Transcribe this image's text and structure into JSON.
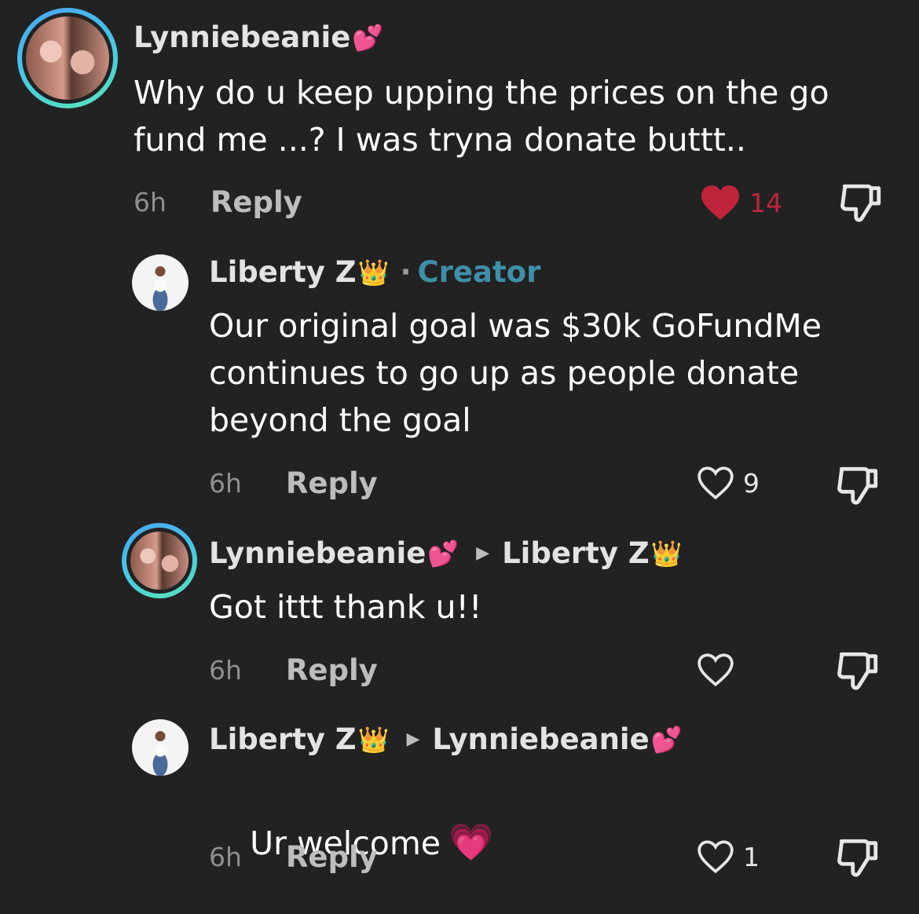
{
  "comments": [
    {
      "username": "Lynniebeanie",
      "username_emoji": "💕",
      "text": "Why do u keep upping the prices on the go\nfund me ...? I was tryna donate buttt..",
      "time": "6h",
      "reply_label": "Reply",
      "likes": "14",
      "liked": true
    },
    {
      "username": "Liberty Z",
      "username_emoji": "👑",
      "separator": "·",
      "badge": "Creator",
      "text": "Our original goal was $30k GoFundMe\ncontinues to go up as people donate\nbeyond the goal",
      "time": "6h",
      "reply_label": "Reply",
      "likes": "9",
      "liked": false
    },
    {
      "username": "Lynniebeanie",
      "username_emoji": "💕",
      "reply_to": "Liberty Z",
      "reply_to_emoji": "👑",
      "text": "Got ittt thank u!!",
      "time": "6h",
      "reply_label": "Reply",
      "likes": "",
      "liked": false
    },
    {
      "username": "Liberty Z",
      "username_emoji": "👑",
      "reply_to": "Lynniebeanie",
      "reply_to_emoji": "💕",
      "text": "Ur welcome",
      "text_emoji": "💗",
      "time": "6h",
      "reply_label": "Reply",
      "likes": "1",
      "liked": false
    }
  ],
  "colors": {
    "background": "#222222",
    "liked_heart": "#c0243c",
    "creator_badge": "#3f8fa8"
  },
  "icons": {
    "like": "heart-outline-icon",
    "liked": "heart-filled-icon",
    "dislike": "thumbs-down-icon",
    "reply_to": "triangle-right-icon"
  }
}
